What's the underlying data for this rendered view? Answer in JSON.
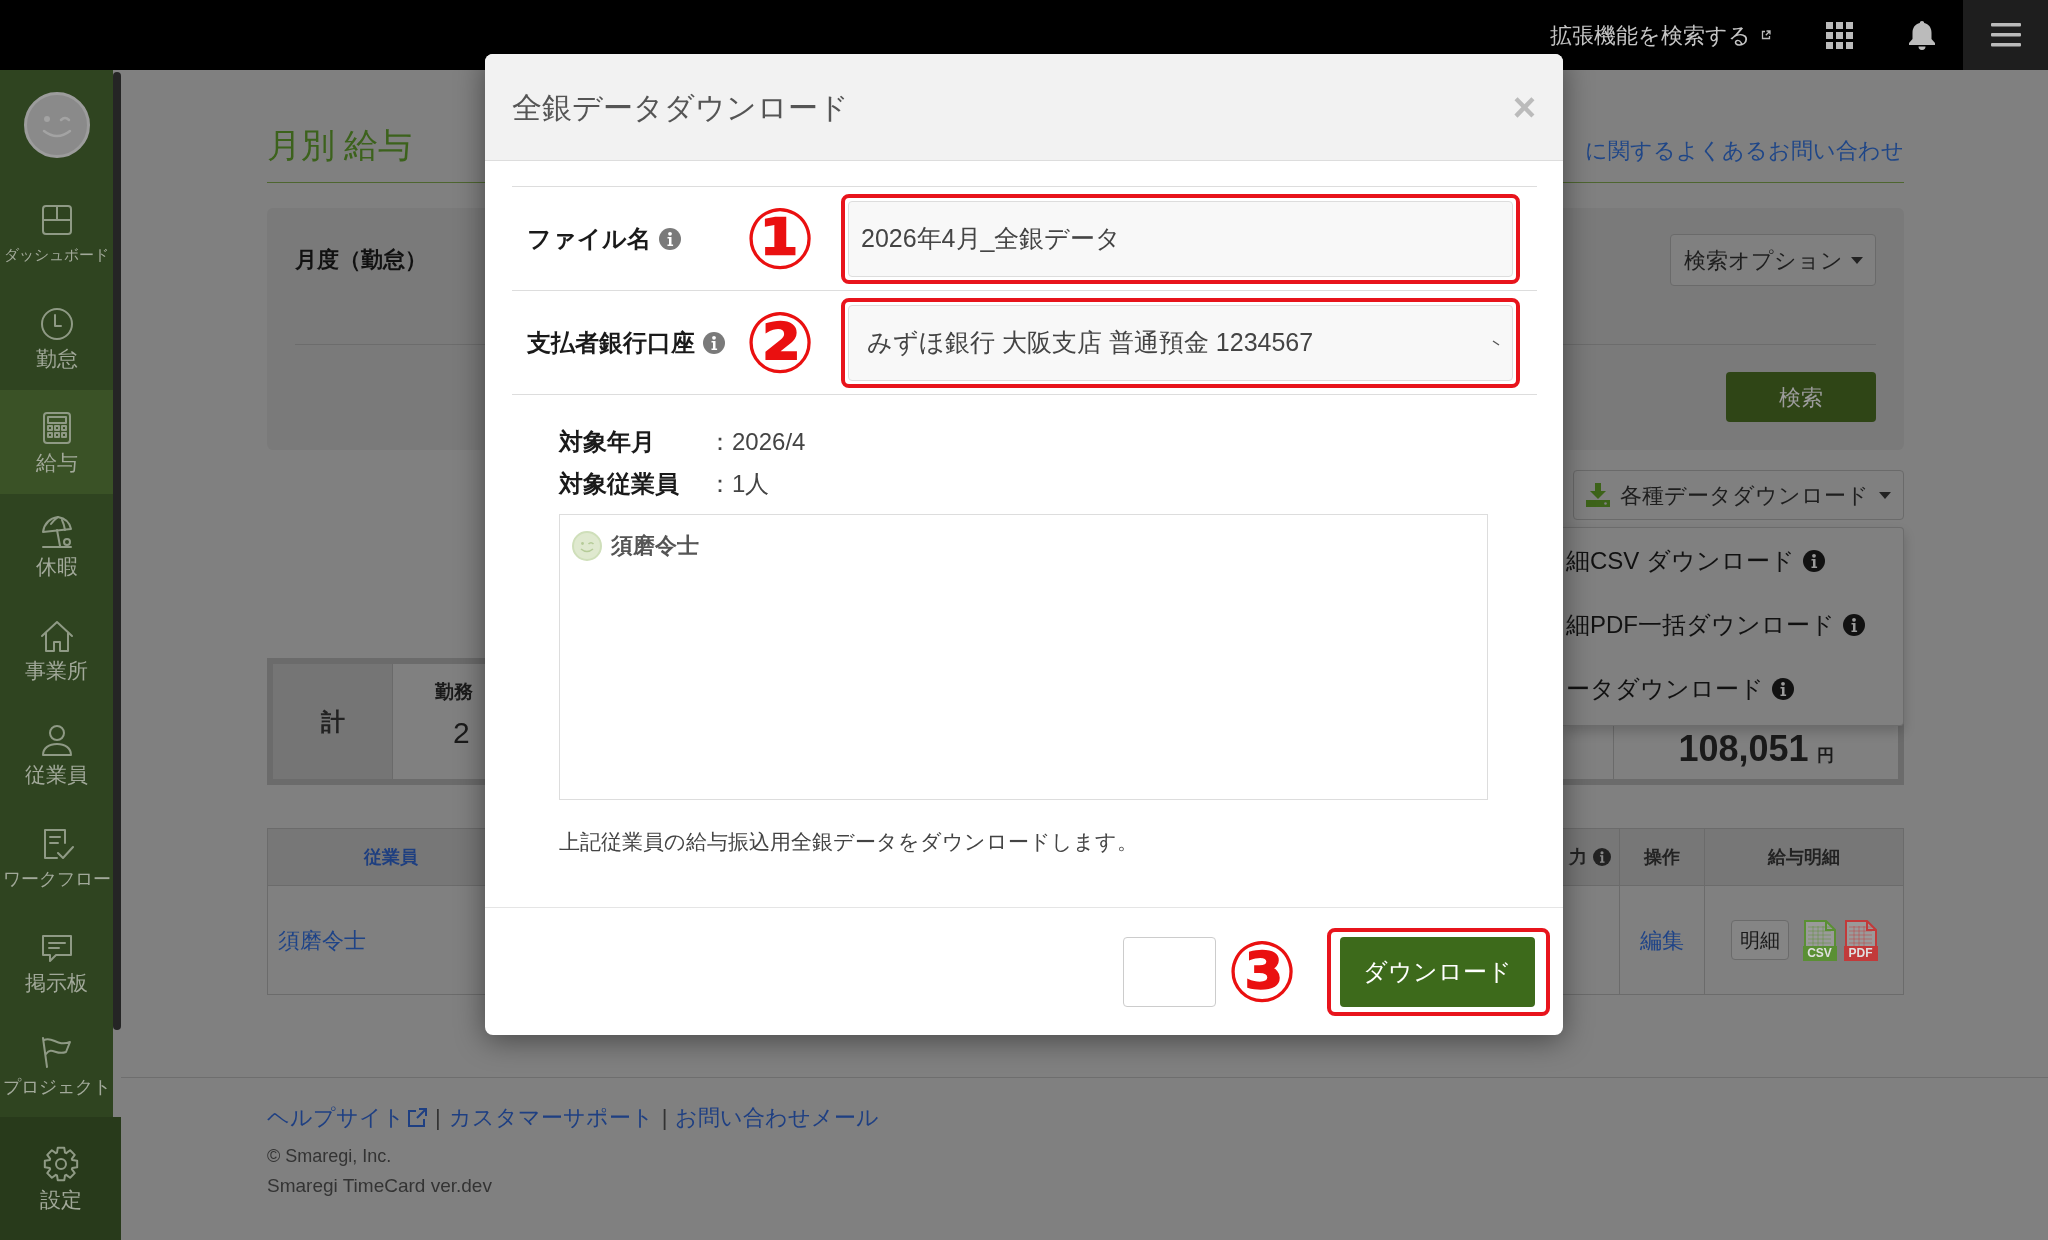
{
  "top_bar": {
    "extension_link": "拡張機能を検索する"
  },
  "sidebar": {
    "items": [
      {
        "kind": "dashboard",
        "label": "ダッシュボード",
        "selected": false
      },
      {
        "kind": "clock",
        "label": "勤怠",
        "selected": false
      },
      {
        "kind": "calculator",
        "label": "給与",
        "selected": true
      },
      {
        "kind": "umbrella",
        "label": "休暇",
        "selected": false
      },
      {
        "kind": "house",
        "label": "事業所",
        "selected": false
      },
      {
        "kind": "person",
        "label": "従業員",
        "selected": false
      },
      {
        "kind": "clipboard",
        "label": "ワークフロー",
        "selected": false
      },
      {
        "kind": "chat",
        "label": "掲示板",
        "selected": false
      },
      {
        "kind": "flag",
        "label": "プロジェクト",
        "selected": false
      }
    ],
    "settings": {
      "label": "設定"
    }
  },
  "page": {
    "title": "月別 給与",
    "faq_link": "に関するよくあるお問い合わせ",
    "search_panel": {
      "month_label": "月度（勤怠）",
      "options_button": "検索オプション",
      "search_button": "検索"
    },
    "download_menu": {
      "button": "各種データダウンロード",
      "items": [
        {
          "label": "細CSV ダウンロード",
          "info": true
        },
        {
          "label": "細PDF一括ダウンロード",
          "info": true
        },
        {
          "label": "ータダウンロード",
          "info": true
        }
      ]
    },
    "summary": {
      "total_label": "計",
      "cells": [
        {
          "label": "勤務",
          "value": "2"
        }
      ],
      "amount": "108,051",
      "unit": "円"
    },
    "table": {
      "columns": [
        {
          "label": "従業員",
          "link": true,
          "info": false
        },
        {
          "label": "力",
          "link": false,
          "info": true
        },
        {
          "label": "操作",
          "link": false,
          "info": false
        },
        {
          "label": "給与明細",
          "link": false,
          "info": false
        }
      ],
      "rows": [
        {
          "employee": "須磨令士",
          "action": "編集",
          "payslip_button": "明細",
          "files": [
            {
              "kind": "csv",
              "label": "CSV"
            },
            {
              "kind": "pdf",
              "label": "PDF"
            }
          ]
        }
      ]
    }
  },
  "footer": {
    "items": [
      {
        "kind": "link",
        "label": "ヘルプサイト",
        "external": true
      },
      {
        "kind": "separator",
        "label": "|"
      },
      {
        "kind": "link",
        "label": "カスタマーサポート",
        "external": false
      },
      {
        "kind": "separator",
        "label": "|"
      },
      {
        "kind": "link",
        "label": "お問い合わせメール",
        "external": false
      }
    ],
    "copyright": "© Smaregi, Inc.",
    "version": "Smaregi TimeCard ver.dev"
  },
  "modal": {
    "title": "全銀データダウンロード",
    "close": "×",
    "fields": [
      {
        "kind": "text",
        "label": "ファイル名",
        "info": true,
        "annotation": "①",
        "highlighted": true,
        "value": "2026年4月_全銀データ"
      },
      {
        "kind": "select",
        "label": "支払者銀行口座",
        "info": true,
        "annotation": "②",
        "highlighted": true,
        "value": "みずほ銀行 大阪支店 普通預金 1234567"
      }
    ],
    "details": [
      {
        "label": "対象年月",
        "value": "：2026/4"
      },
      {
        "label": "対象従業員",
        "value": "：1人"
      }
    ],
    "employees": [
      {
        "name": "須磨令士"
      }
    ],
    "description": "上記従業員の給与振込用全銀データをダウンロードします。",
    "buttons": [
      {
        "kind": "secondary",
        "annotation": "③"
      },
      {
        "kind": "primary",
        "label": "ダウンロード",
        "highlighted": true
      }
    ]
  }
}
